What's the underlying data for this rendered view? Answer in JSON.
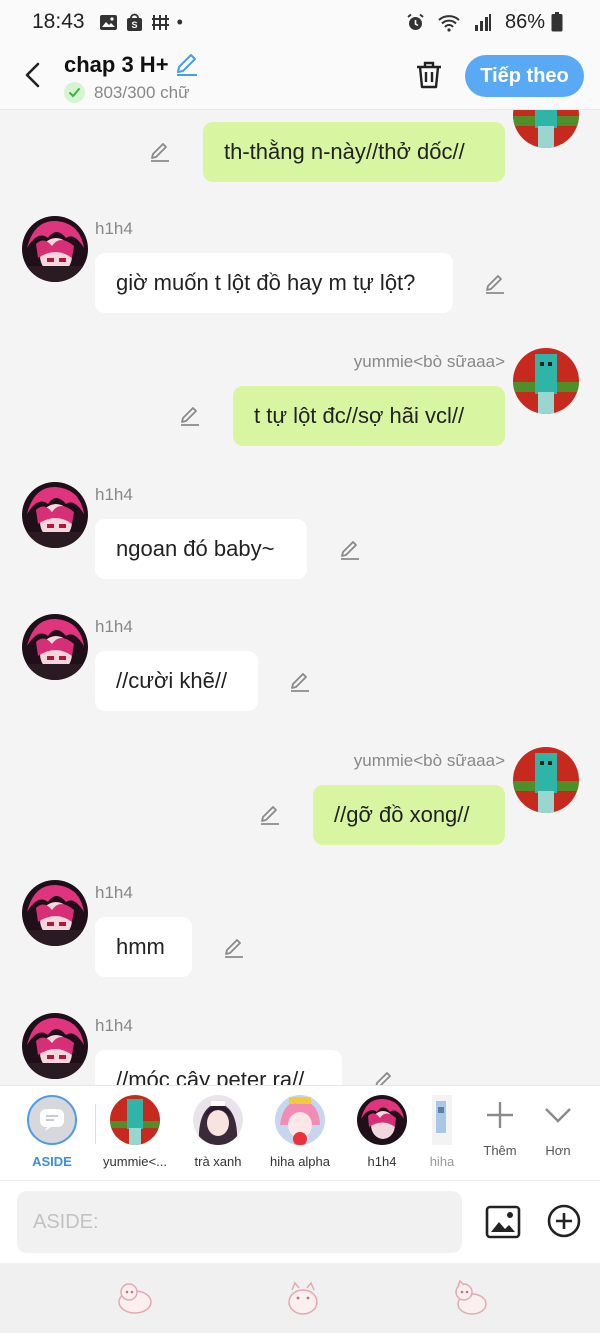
{
  "status_bar": {
    "time": "18:43",
    "battery": "86%",
    "dot": "•"
  },
  "header": {
    "title": "chap 3 H+",
    "word_count": "803/300 chữ",
    "next_label": "Tiếp theo"
  },
  "messages": [
    {
      "side": "out",
      "sender": "",
      "text": "th-thằng n-này//thở dốc//"
    },
    {
      "side": "in",
      "sender": "h1h4",
      "text": "giờ muốn t lột đồ hay m tự lột?"
    },
    {
      "side": "out",
      "sender": "yummie<bò sữaaa>",
      "text": "t tự lột đc//sợ hãi vcl//"
    },
    {
      "side": "in",
      "sender": "h1h4",
      "text": "ngoan đó baby~"
    },
    {
      "side": "in",
      "sender": "h1h4",
      "text": "//cười khẽ//"
    },
    {
      "side": "out",
      "sender": "yummie<bò sữaaa>",
      "text": "//gỡ đồ xong//"
    },
    {
      "side": "in",
      "sender": "h1h4",
      "text": "hmm"
    },
    {
      "side": "in",
      "sender": "h1h4",
      "text": "//móc cây peter ra//"
    }
  ],
  "characters": {
    "aside_label": "ASIDE",
    "items": [
      {
        "name": "yummie<..."
      },
      {
        "name": "trà xanh"
      },
      {
        "name": "hiha alpha"
      },
      {
        "name": "h1h4"
      },
      {
        "name": "hiha"
      }
    ],
    "more_label": "Thêm",
    "expand_label": "Hơn"
  },
  "input": {
    "placeholder": "ASIDE:"
  },
  "colors": {
    "accent": "#5aa9f5",
    "outgoing_bubble": "#d8f5a2",
    "incoming_bubble": "#ffffff",
    "aside_blue": "#3b8de0"
  },
  "icons": [
    "back-arrow-icon",
    "pencil-icon",
    "check-icon",
    "trash-icon",
    "pencil-edit-icon",
    "chat-bubble-icon",
    "plus-icon",
    "chevron-down-icon",
    "image-icon",
    "add-circle-icon",
    "sticker-cat-icon"
  ]
}
